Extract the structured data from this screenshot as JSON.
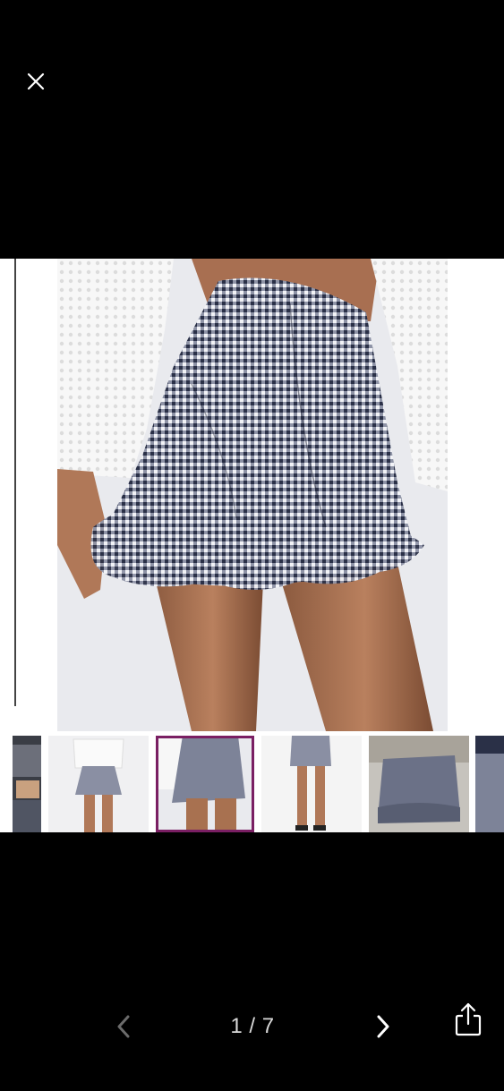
{
  "viewer": {
    "counter": "1 / 7",
    "icons": {
      "close": "close-icon",
      "prev": "chevron-left-icon",
      "next": "chevron-right-icon",
      "share": "share-icon"
    },
    "colors": {
      "background": "#000000",
      "selected_thumb_border": "#7a1f63",
      "prev_disabled": "#6b6b6b",
      "next_enabled": "#ffffff"
    }
  },
  "thumbnails": {
    "count_visible": 6,
    "selected_index": 2
  }
}
